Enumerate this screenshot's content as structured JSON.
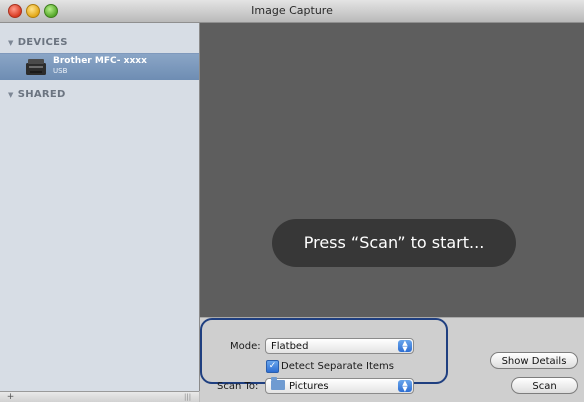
{
  "window": {
    "title": "Image Capture"
  },
  "sidebar": {
    "devices_header": "DEVICES",
    "shared_header": "SHARED",
    "device": {
      "name": "Brother MFC- xxxx",
      "connection": "USB"
    }
  },
  "preview": {
    "hud_text": "Press “Scan” to start..."
  },
  "controls": {
    "mode_label": "Mode:",
    "mode_value": "Flatbed",
    "detect_label": "Detect Separate Items",
    "detect_checked": true,
    "scan_to_label": "Scan To:",
    "scan_to_value": "Pictures",
    "show_details": "Show Details",
    "scan": "Scan"
  },
  "colors": {
    "highlight_border": "#1f3f80",
    "sidebar_selection": "#7b97bc",
    "preview_bg": "#5e5e5e"
  },
  "icons": {
    "device": "printer-icon",
    "destination": "folder-icon",
    "add": "plus-icon"
  }
}
